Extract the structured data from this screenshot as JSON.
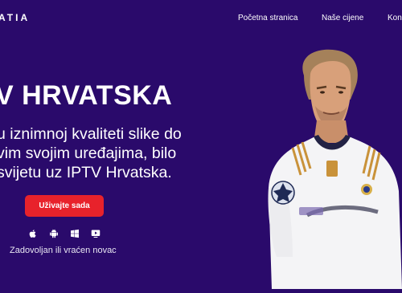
{
  "nav": {
    "brand": "ATIA",
    "links": [
      "Početna stranica",
      "Naše cijene",
      "Kon"
    ]
  },
  "hero": {
    "title": "V HRVATSKA",
    "lines": [
      "u iznimnoj kvaliteti slike do",
      "vim svojim uređajima, bilo",
      "svijetu uz IPTV Hrvatska."
    ],
    "cta_label": "Uživajte sada",
    "platform_icons": [
      "apple-icon",
      "android-icon",
      "windows-icon",
      "tv-play-icon"
    ],
    "guarantee": "Zadovoljan ili vraćen novac"
  },
  "colors": {
    "background": "#2a0a6b",
    "cta": "#e8222b",
    "text": "#ffffff"
  }
}
